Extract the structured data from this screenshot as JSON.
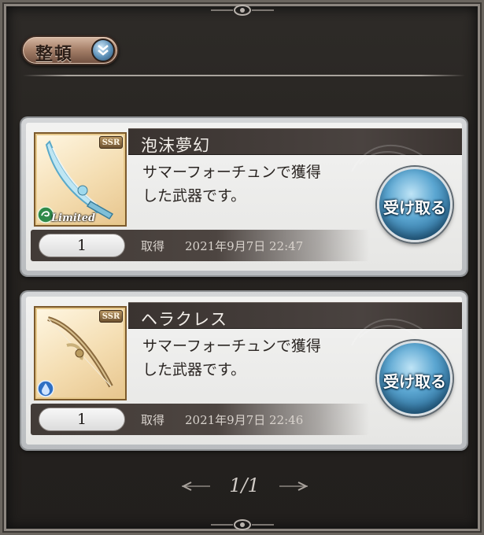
{
  "header": {
    "sort_label": "整頓",
    "sort_icon": "chevron-down-double-icon"
  },
  "items": [
    {
      "name": "泡沫夢幻",
      "rarity": "SSR",
      "tag": "Limited",
      "description": "サマーフォーチュンで獲得\nした武器です。",
      "button_label": "受け取る",
      "quantity": "1",
      "acquired_label": "取得",
      "acquired_datetime": "2021年9月7日 22:47",
      "element_icon": "wind-element-icon",
      "weapon_icon": "scimitar-icon"
    },
    {
      "name": "ヘラクレス",
      "rarity": "SSR",
      "tag": "",
      "description": "サマーフォーチュンで獲得\nした武器です。",
      "button_label": "受け取る",
      "quantity": "1",
      "acquired_label": "取得",
      "acquired_datetime": "2021年9月7日 22:46",
      "element_icon": "water-element-icon",
      "weapon_icon": "bow-icon"
    }
  ],
  "pager": {
    "label": "1/1"
  },
  "colors": {
    "frame": "#2a2724",
    "card": "#e8e8e6",
    "title_bar": "#433c39",
    "button_blue": "#5ba6d1",
    "sort_button": "#a8826b"
  }
}
